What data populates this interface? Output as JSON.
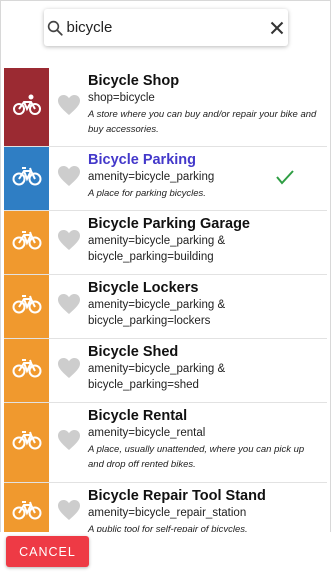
{
  "search": {
    "value": "bicycle",
    "placeholder": ""
  },
  "colors": {
    "shop": "#9b2a32",
    "parking": "#2f7ec4",
    "amenity": "#f0992e",
    "selected_title": "#4338ca",
    "cancel": "#ee3a45"
  },
  "items": [
    {
      "title": "Bicycle Shop",
      "tag1": "shop=bicycle",
      "tag2": "",
      "desc": "A store where you can buy and/or repair your bike and buy accessories.",
      "icon": "bicycle-rider-icon",
      "selected": false
    },
    {
      "title": "Bicycle Parking",
      "tag1": "amenity=bicycle_parking",
      "tag2": "",
      "desc": "A place for parking bicycles.",
      "icon": "bicycle-icon",
      "selected": true
    },
    {
      "title": "Bicycle Parking Garage",
      "tag1": "amenity=bicycle_parking &",
      "tag2": "bicycle_parking=building",
      "desc": "",
      "icon": "bicycle-icon",
      "selected": false
    },
    {
      "title": "Bicycle Lockers",
      "tag1": "amenity=bicycle_parking &",
      "tag2": "bicycle_parking=lockers",
      "desc": "",
      "icon": "bicycle-icon",
      "selected": false
    },
    {
      "title": "Bicycle Shed",
      "tag1": "amenity=bicycle_parking &",
      "tag2": "bicycle_parking=shed",
      "desc": "",
      "icon": "bicycle-icon",
      "selected": false
    },
    {
      "title": "Bicycle Rental",
      "tag1": "amenity=bicycle_rental",
      "tag2": "",
      "desc": "A place, usually unattended, where you can pick up and drop off rented bikes.",
      "icon": "bicycle-icon",
      "selected": false
    },
    {
      "title": "Bicycle Repair Tool Stand",
      "tag1": "amenity=bicycle_repair_station",
      "tag2": "",
      "desc": "A public tool for self-repair of bicycles.",
      "icon": "bicycle-icon",
      "selected": false
    }
  ],
  "footer": {
    "cancel_label": "CANCEL"
  }
}
